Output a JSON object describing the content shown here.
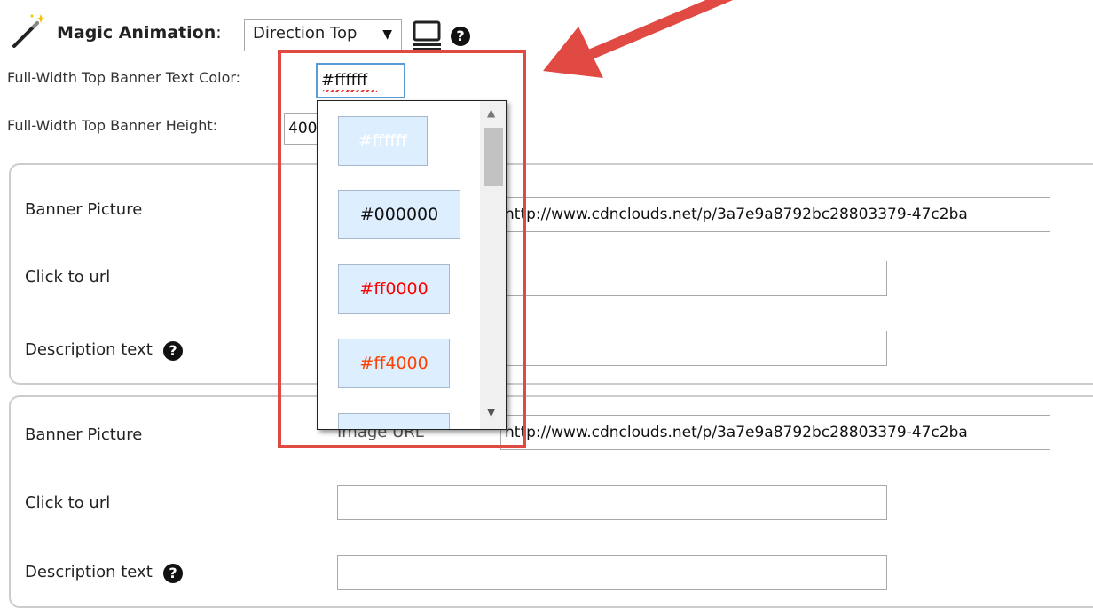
{
  "header": {
    "icon": "magic-wand-icon",
    "title": "Magic Animation",
    "title_colon": ":",
    "animation_select": {
      "value": "Direction Top",
      "arrow": "▼"
    },
    "preview_icon": "monitor-icon",
    "help": "?"
  },
  "settings": {
    "text_color_label": "Full-Width Top Banner Text Color:",
    "text_color_value": "#ffffff",
    "height_label": "Full-Width Top Banner Height:",
    "height_value": "400"
  },
  "color_dropdown": {
    "options": [
      {
        "label": "#ffffff",
        "color": "#ffffff"
      },
      {
        "label": "#000000",
        "color": "#000000"
      },
      {
        "label": "#ff0000",
        "color": "#ff0000"
      },
      {
        "label": "#ff4000",
        "color": "#ff4000"
      },
      {
        "label": "",
        "color": "#ddeeff"
      }
    ]
  },
  "panels": [
    {
      "banner_picture_label": "Banner Picture",
      "image_url_value": "http://www.cdnclouds.net/p/3a7e9a8792bc28803379-47c2ba",
      "click_url_label": "Click to url",
      "click_url_value": "",
      "description_label": "Description text",
      "description_value": ""
    },
    {
      "banner_picture_label": "Banner Picture",
      "image_url_label": "Image URL",
      "image_url_value": "http://www.cdnclouds.net/p/3a7e9a8792bc28803379-47c2ba",
      "click_url_label": "Click to url",
      "click_url_value": "",
      "description_label": "Description text",
      "description_value": ""
    }
  ],
  "annotation": {
    "highlight_color": "#e14a43"
  }
}
